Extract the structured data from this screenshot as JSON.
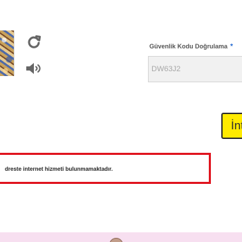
{
  "captcha": {
    "label": "Güvenlik Kodu Doğrulama",
    "required_mark": "*",
    "input_value": "DW63J2",
    "refresh_icon": "refresh-icon",
    "audio_icon": "speaker-icon"
  },
  "actions": {
    "submit_label": "İnt"
  },
  "result": {
    "message": "dreste internet hizmeti bulunmamaktadır."
  },
  "colors": {
    "accent_yellow": "#ffea00",
    "error_red": "#e0151f",
    "required_blue": "#1e66d0",
    "footer_pink": "#f7dff0"
  }
}
